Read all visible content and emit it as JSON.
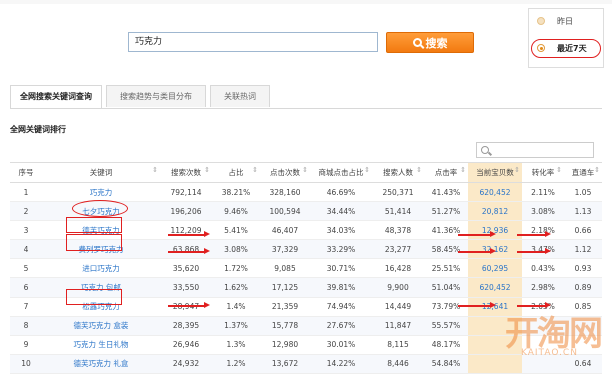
{
  "search": {
    "value": "巧克力",
    "button_label": "搜索"
  },
  "range": {
    "options": [
      "昨日",
      "最近7天"
    ],
    "selected": "最近7天"
  },
  "tabs": [
    "全网搜索关键词查询",
    "搜索趋势与类目分布",
    "关联热词"
  ],
  "section_title": "全网关键词排行",
  "table": {
    "headers": [
      "序号",
      "关键词",
      "搜索次数",
      "占比",
      "点击次数",
      "商城点击占比",
      "搜索人数",
      "点击率",
      "当前宝贝数",
      "转化率",
      "直通车"
    ],
    "rows": [
      [
        "1",
        "巧克力",
        "792,114",
        "38.21%",
        "328,160",
        "46.69%",
        "250,371",
        "41.43%",
        "620,452",
        "2.11%",
        "1.05"
      ],
      [
        "2",
        "七夕巧克力",
        "196,206",
        "9.46%",
        "100,594",
        "34.44%",
        "51,414",
        "51.27%",
        "20,812",
        "3.08%",
        "1.13"
      ],
      [
        "3",
        "德芙巧克力",
        "112,209",
        "5.41%",
        "46,407",
        "34.03%",
        "48,378",
        "41.36%",
        "12,936",
        "2.18%",
        "0.66"
      ],
      [
        "4",
        "费列罗巧克力",
        "63,868",
        "3.08%",
        "37,329",
        "33.29%",
        "23,277",
        "58.45%",
        "32,162",
        "3.47%",
        "1.12"
      ],
      [
        "5",
        "进口巧克力",
        "35,620",
        "1.72%",
        "9,085",
        "30.71%",
        "16,428",
        "25.51%",
        "60,295",
        "0.43%",
        "0.93"
      ],
      [
        "6",
        "巧克力 包邮",
        "33,550",
        "1.62%",
        "17,125",
        "39.81%",
        "9,900",
        "51.04%",
        "620,452",
        "2.98%",
        "0.89"
      ],
      [
        "7",
        "松露巧克力",
        "28,947",
        "1.4%",
        "21,359",
        "74.94%",
        "14,449",
        "73.79%",
        "12,641",
        "2.03%",
        "0.85"
      ],
      [
        "8",
        "德芙巧克力 盒装",
        "28,395",
        "1.37%",
        "15,778",
        "27.67%",
        "11,847",
        "55.57%",
        "",
        "",
        ""
      ],
      [
        "9",
        "巧克力 生日礼物",
        "26,946",
        "1.3%",
        "12,980",
        "30.01%",
        "8,115",
        "48.17%",
        "",
        "",
        ""
      ],
      [
        "10",
        "德芙巧克力 礼盒",
        "24,932",
        "1.2%",
        "13,672",
        "14.22%",
        "8,446",
        "54.84%",
        "",
        "",
        "0.64"
      ]
    ]
  },
  "watermark": {
    "main": "开淘网",
    "sub": "KAITAO.CN"
  },
  "colors": {
    "accent": "#f27a10",
    "link": "#2a74c8",
    "highlight": "#fbe9c8",
    "annotation": "#e02020"
  }
}
